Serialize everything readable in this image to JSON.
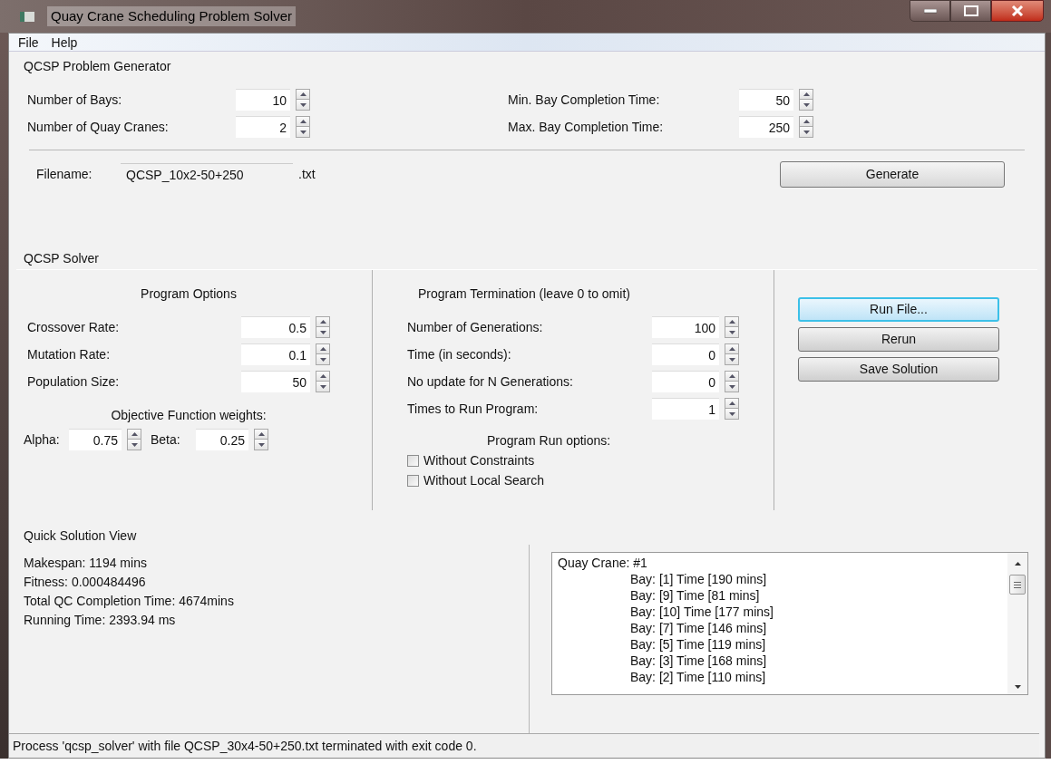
{
  "window": {
    "title": "Quay Crane Scheduling Problem Solver"
  },
  "menu": [
    "File",
    "Help"
  ],
  "generator": {
    "title": "QCSP Problem Generator",
    "fields_left": [
      {
        "label": "Number of Bays:",
        "value": "10"
      },
      {
        "label": "Number of Quay Cranes:",
        "value": "2"
      }
    ],
    "fields_right": [
      {
        "label": "Min. Bay Completion Time:",
        "value": "50"
      },
      {
        "label": "Max. Bay Completion Time:",
        "value": "250"
      }
    ],
    "filename": {
      "label": "Filename:",
      "value": "QCSP_10x2-50+250",
      "extension": ".txt"
    },
    "button": "Generate"
  },
  "solver": {
    "title": "QCSP Solver",
    "program_options": {
      "title": "Program Options",
      "fields": [
        {
          "label": "Crossover Rate:",
          "value": "0.5"
        },
        {
          "label": "Mutation Rate:",
          "value": "0.1"
        },
        {
          "label": "Population Size:",
          "value": "50"
        }
      ],
      "weights_title": "Objective Function weights:",
      "weights": [
        {
          "label": "Alpha:",
          "value": "0.75"
        },
        {
          "label": "Beta:",
          "value": "0.25"
        }
      ]
    },
    "termination": {
      "title": "Program Termination (leave 0 to omit)",
      "fields": [
        {
          "label": "Number of Generations:",
          "value": "100"
        },
        {
          "label": "Time (in seconds):",
          "value": "0"
        },
        {
          "label": "No update for N Generations:",
          "value": "0"
        },
        {
          "label": "Times to Run Program:",
          "value": "1"
        }
      ],
      "run_options_title": "Program Run options:",
      "checkboxes": [
        {
          "label": "Without Constraints",
          "checked": false
        },
        {
          "label": "Without Local Search",
          "checked": false
        }
      ]
    },
    "buttons": [
      {
        "label": "Run File...",
        "focused": true
      },
      {
        "label": "Rerun",
        "focused": false
      },
      {
        "label": "Save Solution",
        "focused": false
      }
    ]
  },
  "quick_view": {
    "title": "Quick Solution View",
    "stats": [
      "Makespan: 1194 mins",
      "Fitness: 0.000484496",
      "Total QC Completion Time: 4674mins",
      "Running Time: 2393.94 ms"
    ],
    "list": [
      {
        "text": "Quay Crane: #1",
        "children": [
          {
            "text": "Bay: [1] Time [190 mins]"
          },
          {
            "text": "Bay: [9] Time [81 mins]"
          },
          {
            "text": "Bay: [10] Time [177 mins]"
          },
          {
            "text": "Bay: [7] Time [146 mins]"
          },
          {
            "text": "Bay: [5] Time [119 mins]"
          },
          {
            "text": "Bay: [3] Time [168 mins]"
          },
          {
            "text": "Bay: [2] Time [110 mins]"
          }
        ]
      }
    ]
  },
  "status_bar": "Process 'qcsp_solver' with file QCSP_30x4-50+250.txt terminated with exit code 0."
}
